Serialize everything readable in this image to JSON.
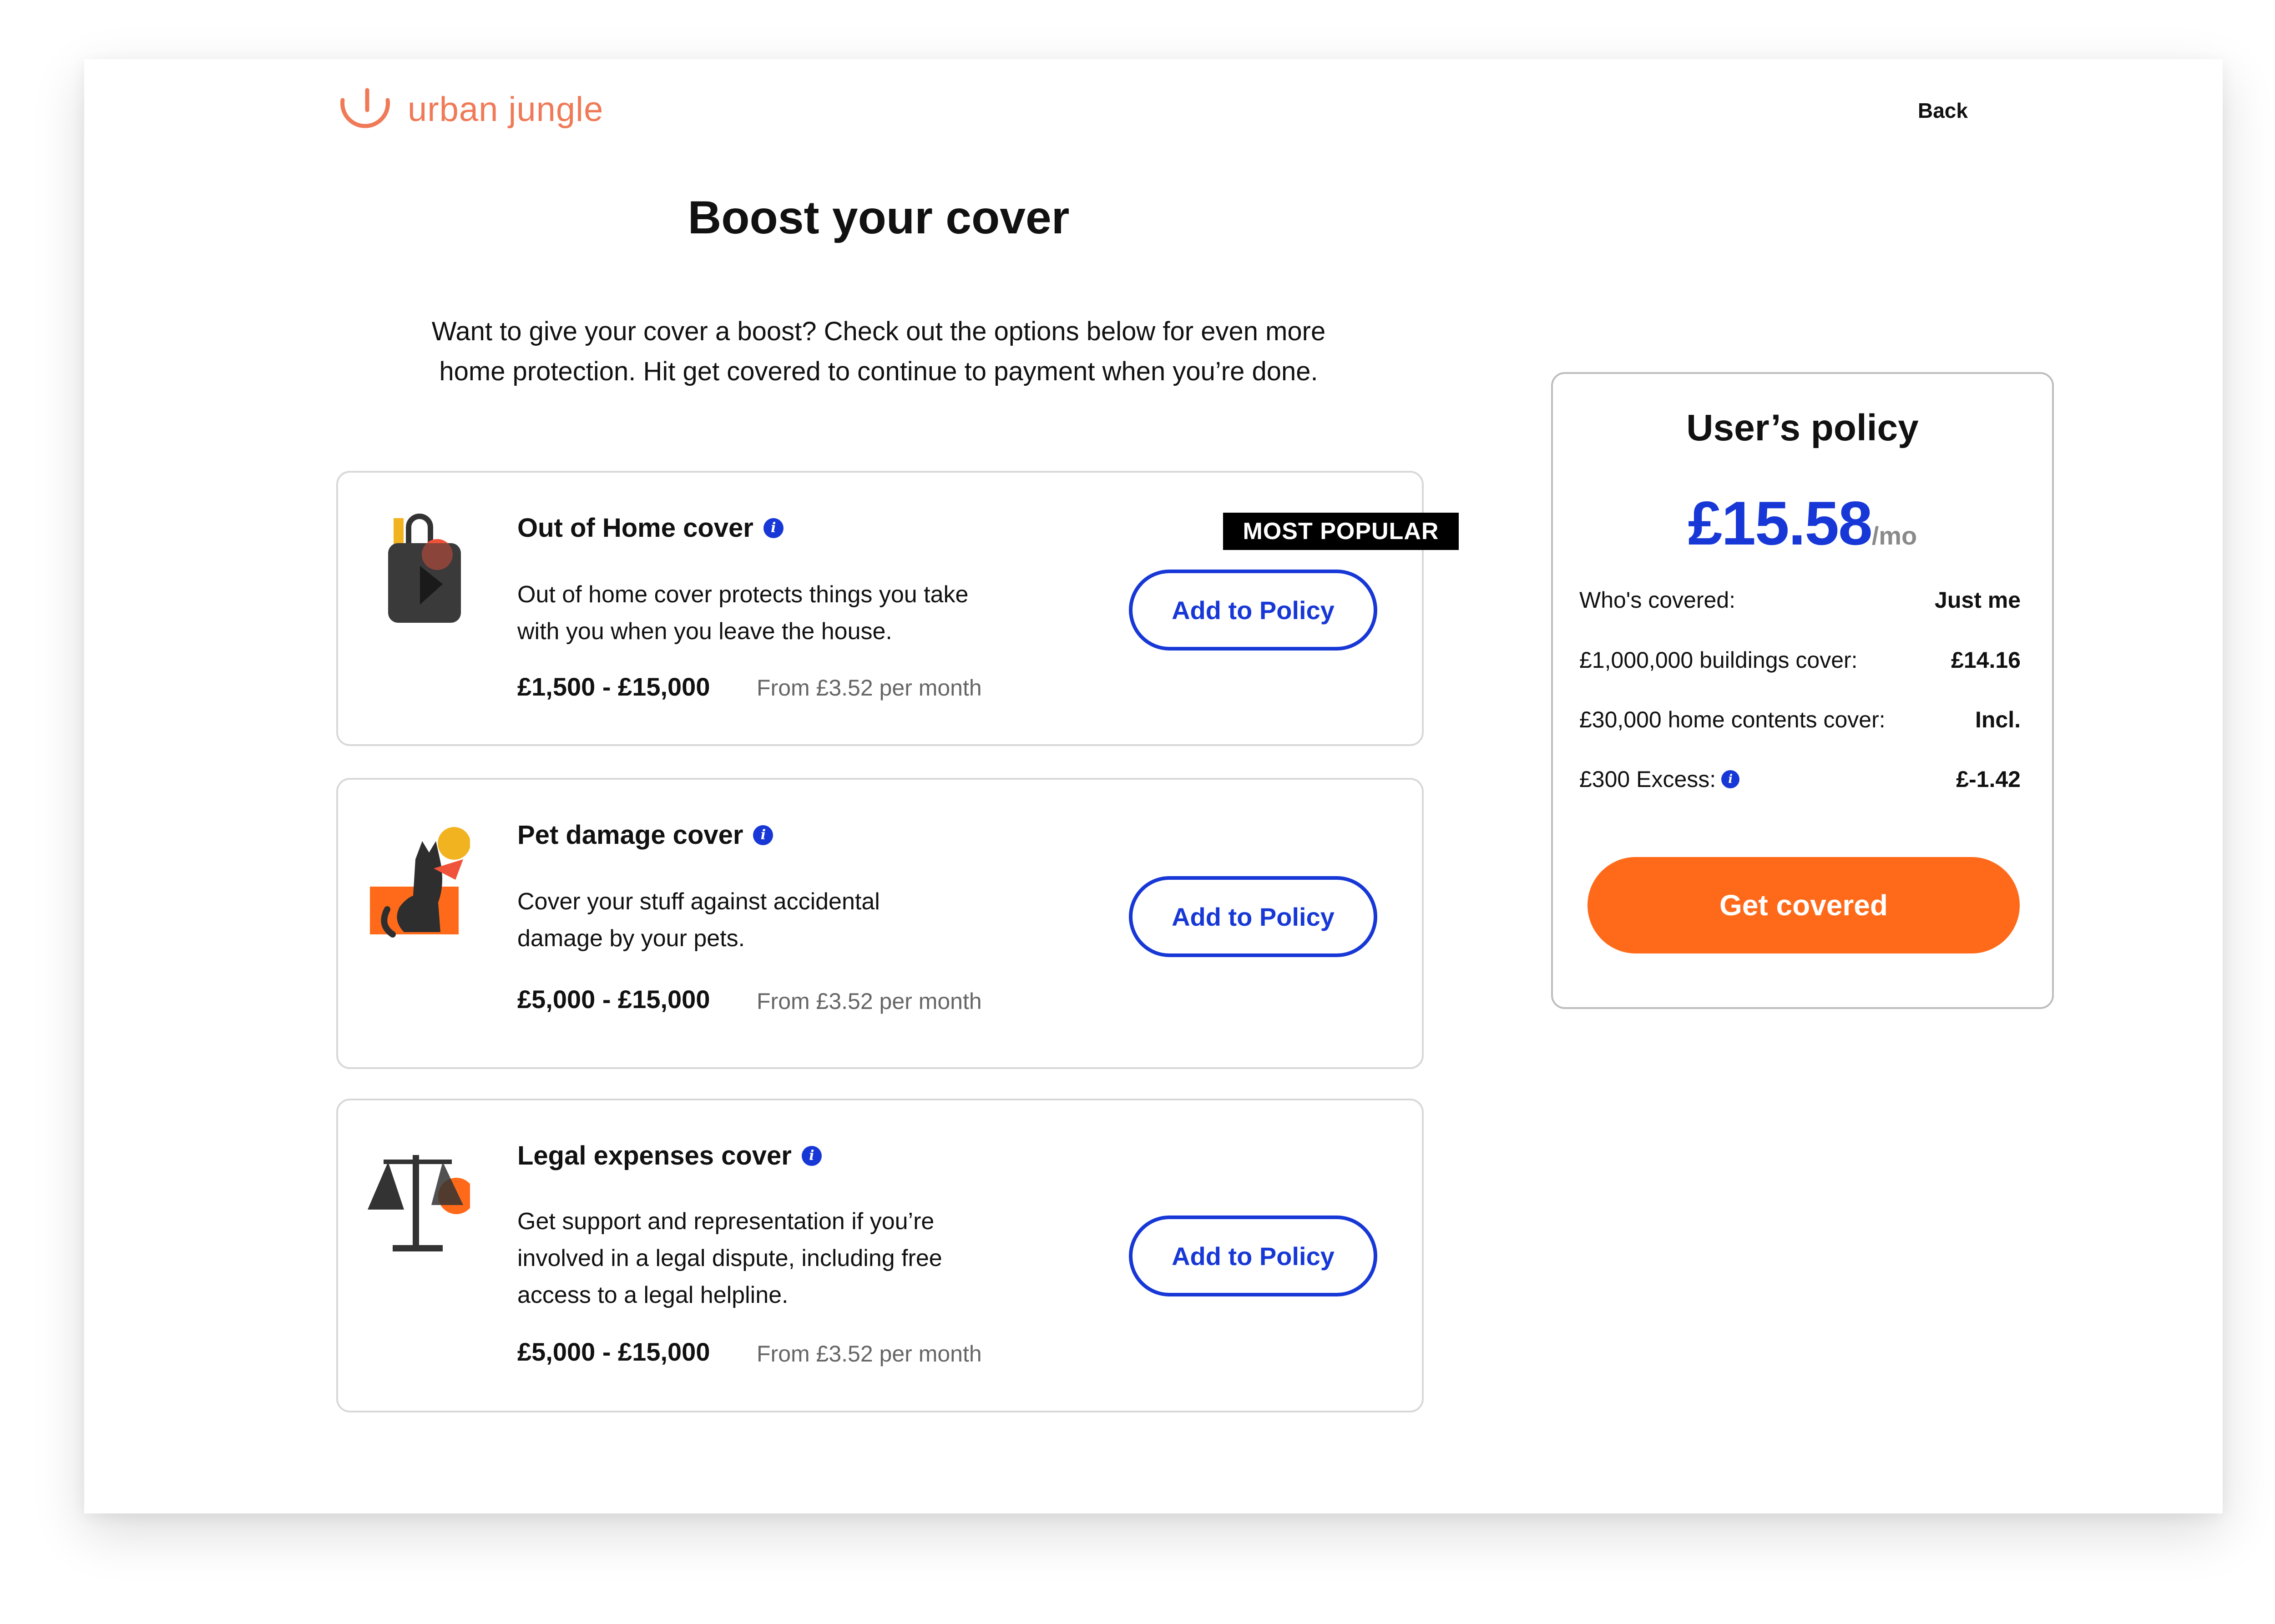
{
  "header": {
    "logo_text": "urban jungle",
    "back_label": "Back"
  },
  "page": {
    "title": "Boost your cover",
    "intro_line1": "Want to give your cover a boost? Check out the options below for even more",
    "intro_line2": "home protection. Hit get covered to continue to payment when you’re done."
  },
  "options": [
    {
      "title": "Out of Home cover",
      "badge": "MOST POPULAR",
      "desc_line1": "Out of home cover protects things you take",
      "desc_line2": "with you when you leave the house.",
      "range": "£1,500 - £15,000",
      "from": "From £3.52 per month",
      "button": "Add to Policy",
      "icon": "handbag-icon"
    },
    {
      "title": "Pet damage cover",
      "desc_line1": "Cover your stuff against accidental",
      "desc_line2": "damage by your pets.",
      "range": "£5,000 - £15,000",
      "from": "From £3.52 per month",
      "button": "Add to Policy",
      "icon": "cat-icon"
    },
    {
      "title": "Legal expenses cover",
      "desc_line1": "Get support and representation if you’re",
      "desc_line2": "involved in a legal dispute, including free",
      "desc_line3": "access to a legal helpline.",
      "range": "£5,000 - £15,000",
      "from": "From £3.52 per month",
      "button": "Add to Policy",
      "icon": "scales-icon"
    }
  ],
  "policy": {
    "title": "User’s policy",
    "price": "£15.58",
    "price_unit": "/mo",
    "rows": [
      {
        "label": "Who's covered:",
        "value": "Just me"
      },
      {
        "label": "£1,000,000 buildings cover:",
        "value": "£14.16"
      },
      {
        "label": "£30,000 home contents cover:",
        "value": "Incl."
      },
      {
        "label": "£300 Excess:",
        "value": "£-1.42"
      }
    ],
    "cta": "Get covered"
  },
  "colors": {
    "brand_orange": "#F07A57",
    "accent_blue": "#1738D6",
    "cta_orange": "#FF6A1A",
    "badge_black": "#000000"
  }
}
